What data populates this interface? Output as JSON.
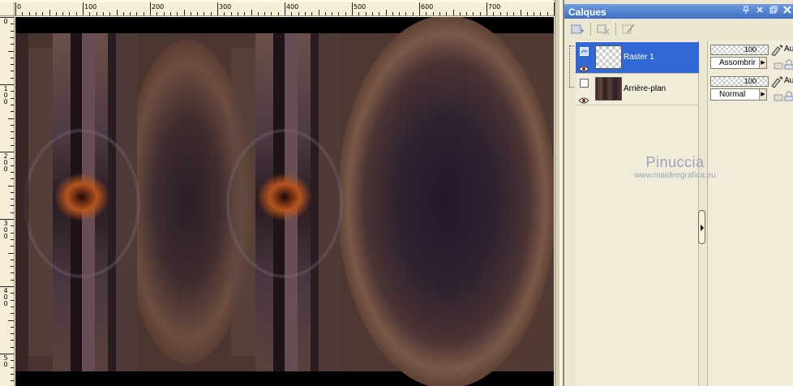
{
  "ruler": {
    "h_labels": [
      "0",
      "100",
      "200",
      "300",
      "400",
      "500",
      "600",
      "700"
    ],
    "v_labels": [
      "0",
      "1\n0\n0",
      "2\n0\n0",
      "3\n0\n0",
      "4\n0\n0",
      "5\n0"
    ]
  },
  "canvas": {
    "description_icon": "image-canvas"
  },
  "palette": {
    "title": "Calques",
    "title_buttons": [
      "⊟",
      "✕",
      "▭",
      "✕"
    ],
    "toolbar_icons": [
      "new-layer-icon",
      "delete-layer-icon",
      "mask-icon"
    ],
    "layers": [
      {
        "name": "Raster 1",
        "opacity": "100",
        "blend": "Assombrir",
        "auto": "Aut",
        "selected": true
      },
      {
        "name": "Arrière-plan",
        "opacity": "100",
        "blend": "Normal",
        "auto": "Aut",
        "selected": false
      }
    ]
  },
  "watermark": {
    "line1": "Pinuccia",
    "line2": "www.maidiregrafica.eu"
  },
  "colors": {
    "title_bar": "#3f6fc6",
    "selected_row": "#3168d6",
    "canvas_brown": "#6b4a3c",
    "canvas_purple": "#2a1e30"
  }
}
